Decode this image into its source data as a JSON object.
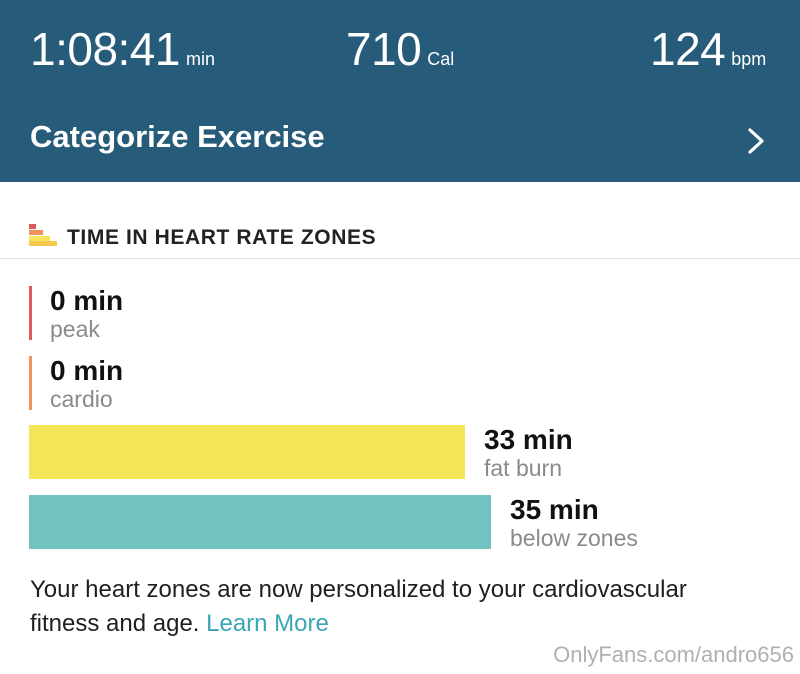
{
  "header": {
    "stats": [
      {
        "value": "1:08:41",
        "unit": "min"
      },
      {
        "value": "710",
        "unit": "Cal"
      },
      {
        "value": "124",
        "unit": "bpm"
      }
    ],
    "categorize_label": "Categorize Exercise"
  },
  "zones_section": {
    "title": "TIME IN HEART RATE ZONES",
    "zones": [
      {
        "minutes": "0 min",
        "label": "peak",
        "value_min": 0,
        "color": "#e05a5a"
      },
      {
        "minutes": "0 min",
        "label": "cardio",
        "value_min": 0,
        "color": "#f0935a"
      },
      {
        "minutes": "33 min",
        "label": "fat burn",
        "value_min": 33,
        "color": "#f6e457"
      },
      {
        "minutes": "35 min",
        "label": "below zones",
        "value_min": 35,
        "color": "#71c2c1"
      }
    ]
  },
  "note": {
    "text": "Your heart zones are now personalized to your cardiovascular fitness and age. ",
    "link": "Learn More"
  },
  "watermark": "OnlyFans.com/andro656",
  "colors": {
    "header_bg": "#265b7a",
    "link": "#3aa6b4"
  }
}
